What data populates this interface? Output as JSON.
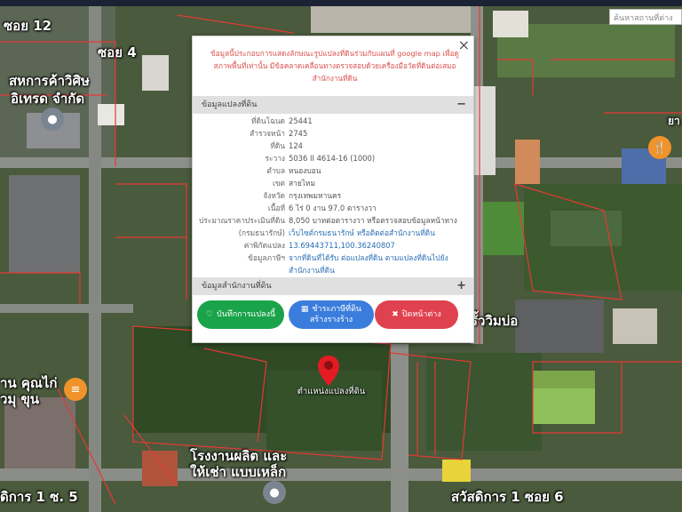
{
  "search": {
    "placeholder": "ค้นหาสถานที่ต่าง"
  },
  "map_labels": [
    "ซอย 12",
    "ซอย 4",
    "สหการค้าวิศิษ",
    "อิเทรด จำกัด",
    "โรงงานผลิต และ",
    "ให้เช่า แบบเหล็ก",
    "สวัสดิการ 1 ซอย 6",
    "รั้ววิมบ่อ",
    "าน คุณไก่",
    "วมุ ขุน",
    "ดิการ 1 ซ. 5",
    "ยา"
  ],
  "panel": {
    "notice": "ข้อมูลนี้ประกอบการแสดงลักษณะรูปแปลงที่ดินร่วมกับแผนที่ google map เพื่อดูสภาพพื้นที่เท่านั้น มีข้อคลาดเคลื่อนทางตรวจสอบด้วยเครื่องมือวัดที่ดินต่อเสมอ สำนักงานที่ดิน",
    "section1": "ข้อมูลแปลงที่ดิน",
    "section1_toggle": "−",
    "section2": "ข้อมูลสำนักงานที่ดิน",
    "section2_toggle": "+",
    "close": "×",
    "rows": [
      {
        "key": "ที่ดินโฉนด",
        "value": "25441"
      },
      {
        "key": "สำรวจหน้า",
        "value": "2745"
      },
      {
        "key": "ที่ดิน",
        "value": "124"
      },
      {
        "key": "ระวาง",
        "value": "5036 II 4614-16 (1000)"
      },
      {
        "key": "ตำบล",
        "value": "หนองบอน"
      },
      {
        "key": "เขต",
        "value": "สายไหม"
      },
      {
        "key": "จังหวัด",
        "value": "กรุงเทพมหานคร"
      },
      {
        "key": "เนื้อที่",
        "value": "6 ไร่ 0 งาน 97.0 ตารางวา"
      },
      {
        "key": "ประมาณราคาประเมินที่ดิน",
        "value": "8,050 บาทต่อตารางวา หรือตรวจสอบข้อมูลหน้าทาง"
      },
      {
        "key": "(กรมธนารักษ์)",
        "value": "เว็บไซต์กรมธนารักษ์ หรือติดต่อสำนักงานที่ดิน"
      },
      {
        "key": "ค่าพิกัดแปลง",
        "value": "13.69443711,100.36240807"
      },
      {
        "key": "ข้อมูลภาษีฯ",
        "value": "จากที่ดินที่ได้รับ ต่อแปลงที่ดิน ตามแปลงที่ดินไปยัง"
      },
      {
        "key": "",
        "value": "สำนักงานที่ดิน"
      }
    ],
    "btn_save": "บันทึกการแปลงนี้",
    "btn_tax_1": "ชำระภาษีที่ดิน",
    "btn_tax_2": "สร้างรางร้าง",
    "btn_close": "ปิดหน้าต่าง"
  },
  "pin_caption": "ตำแหน่งแปลงที่ดิน",
  "colors": {
    "boundary": "#e53935",
    "vegetation": "#3f5a2e",
    "notice_text": "#d9534f",
    "btn_green": "#1aa34a",
    "btn_blue": "#3b7ddd",
    "btn_red": "#e0414e",
    "link": "#2a6fb5"
  }
}
